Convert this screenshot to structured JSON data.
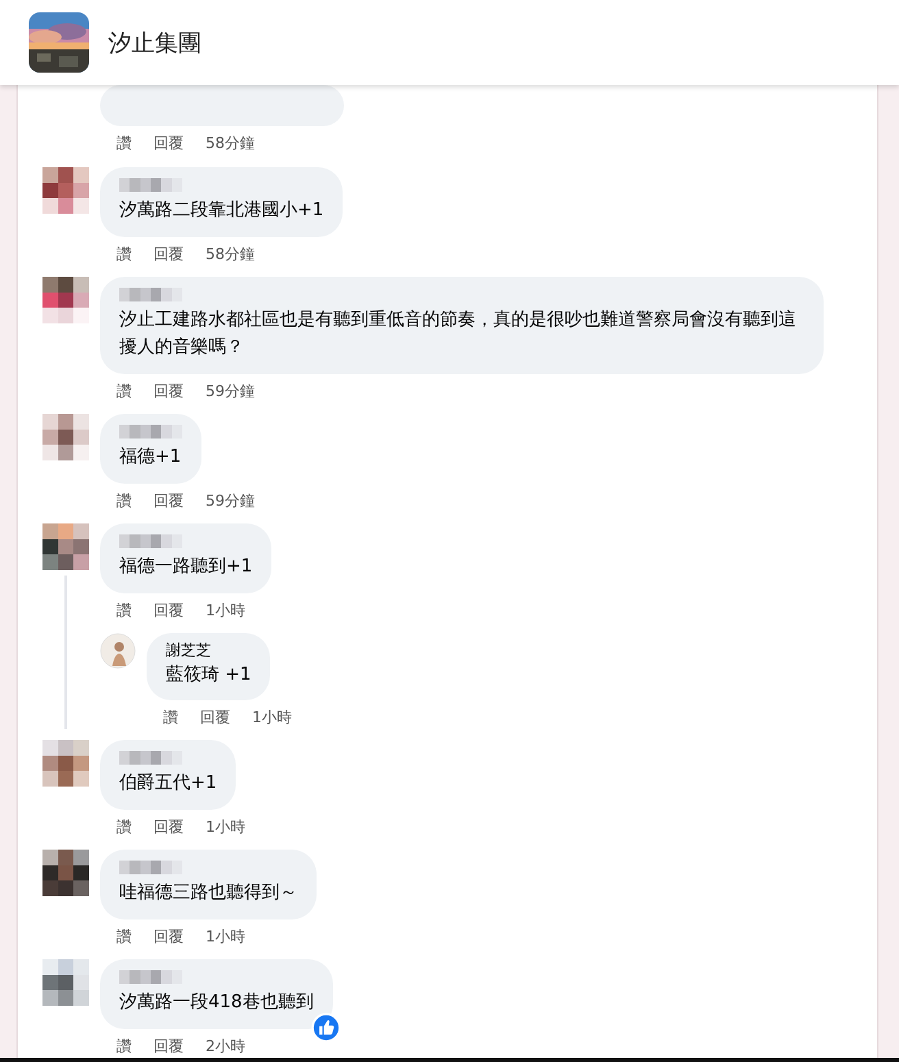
{
  "group": {
    "name": "汐止集團"
  },
  "comments": [
    {
      "kind": "partial",
      "actions": {
        "like": "讚",
        "reply": "回覆",
        "time": "58分鐘"
      }
    },
    {
      "kind": "full",
      "text": "汐萬路二段靠北港國小+1",
      "actions": {
        "like": "讚",
        "reply": "回覆",
        "time": "58分鐘"
      }
    },
    {
      "kind": "full",
      "text": "汐止工建路水都社區也是有聽到重低音的節奏，真的是很吵也難道警察局會沒有聽到這擾人的音樂嗎？",
      "actions": {
        "like": "讚",
        "reply": "回覆",
        "time": "59分鐘"
      }
    },
    {
      "kind": "full",
      "text": "福德+1",
      "actions": {
        "like": "讚",
        "reply": "回覆",
        "time": "59分鐘"
      }
    },
    {
      "kind": "full",
      "text": "福德一路聽到+1",
      "actions": {
        "like": "讚",
        "reply": "回覆",
        "time": "1小時"
      },
      "replies": [
        {
          "name": "謝芝芝",
          "text": "藍筱琦 +1",
          "actions": {
            "like": "讚",
            "reply": "回覆",
            "time": "1小時"
          }
        }
      ]
    },
    {
      "kind": "full",
      "text": "伯爵五代+1",
      "actions": {
        "like": "讚",
        "reply": "回覆",
        "time": "1小時"
      }
    },
    {
      "kind": "full",
      "text": "哇福德三路也聽得到～",
      "actions": {
        "like": "讚",
        "reply": "回覆",
        "time": "1小時"
      }
    },
    {
      "kind": "full",
      "text": "汐萬路一段418巷也聽到",
      "liked": true,
      "actions": {
        "like": "讚",
        "reply": "回覆",
        "time": "2小時"
      }
    }
  ]
}
